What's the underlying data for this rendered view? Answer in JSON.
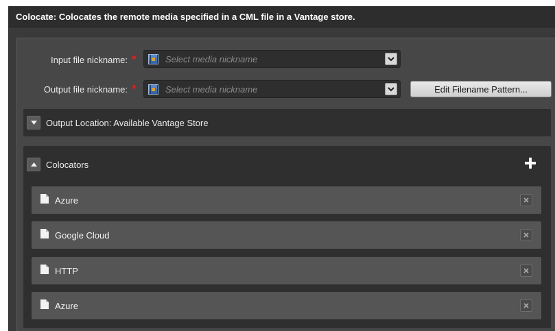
{
  "title": "Colocate: Colocates the remote media specified in a CML file in a Vantage store.",
  "input": {
    "label": "Input file nickname:",
    "placeholder": "Select media nickname",
    "required_mark": "*"
  },
  "output": {
    "label": "Output file nickname:",
    "placeholder": "Select media nickname",
    "required_mark": "*"
  },
  "edit_button": "Edit Filename Pattern...",
  "output_location": {
    "title": "Output Location: Available Vantage Store",
    "expanded": false
  },
  "colocators": {
    "title": "Colocators",
    "expanded": true,
    "items": [
      {
        "label": "Azure"
      },
      {
        "label": "Google Cloud"
      },
      {
        "label": "HTTP"
      },
      {
        "label": "Azure"
      }
    ]
  },
  "icons": {
    "media": "media-nickname-icon",
    "dropdown": "chevron-down-icon",
    "collapse": "triangle-up-icon",
    "expand": "triangle-down-icon",
    "add": "plus-icon",
    "document": "document-icon",
    "remove": "close-icon"
  },
  "colors": {
    "required": "#e02020",
    "panel": "#474747",
    "section": "#2f2f2f",
    "item": "#555555"
  }
}
